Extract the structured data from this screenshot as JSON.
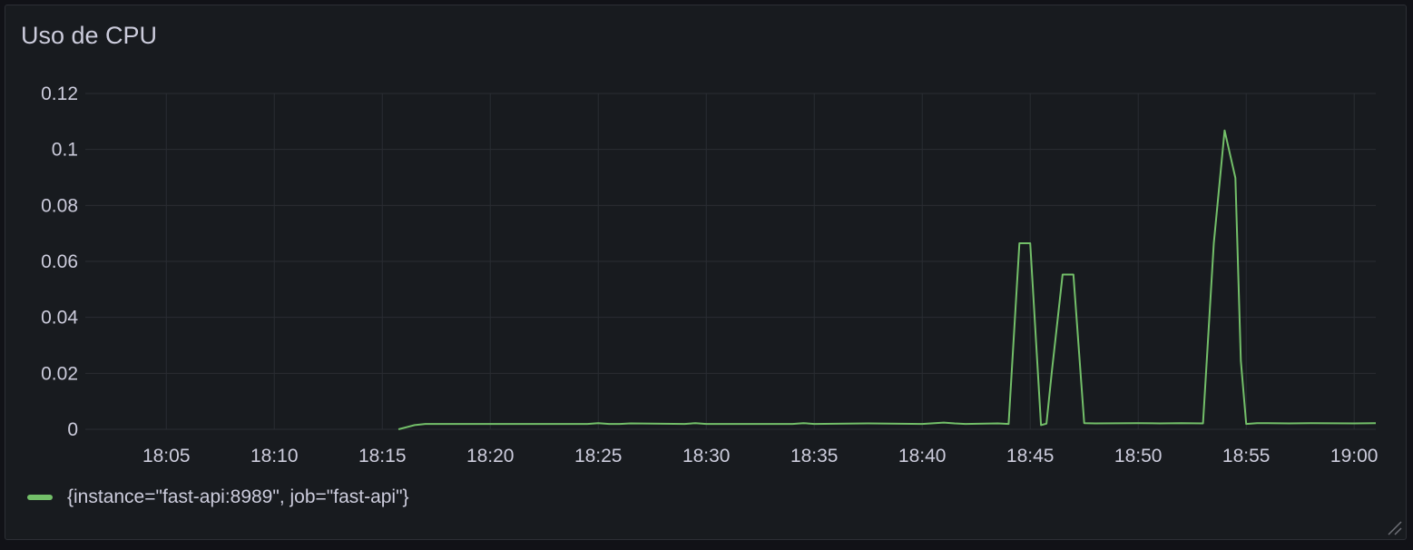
{
  "panel": {
    "title": "Uso de CPU"
  },
  "chart_data": {
    "type": "line",
    "title": "Uso de CPU",
    "xlabel": "",
    "ylabel": "",
    "x_ticks": [
      "18:05",
      "18:10",
      "18:15",
      "18:20",
      "18:25",
      "18:30",
      "18:35",
      "18:40",
      "18:45",
      "18:50",
      "18:55",
      "19:00"
    ],
    "y_ticks": [
      "0",
      "0.02",
      "0.04",
      "0.06",
      "0.08",
      "0.1",
      "0.12"
    ],
    "ylim": [
      0,
      0.12
    ],
    "xlim": [
      "18:01:15",
      "19:01:00"
    ],
    "grid": true,
    "legend_position": "bottom-left",
    "series": [
      {
        "name": "{instance=\"fast-api:8989\", job=\"fast-api\"}",
        "color": "#73bf69",
        "x": [
          "18:15:45",
          "18:16:30",
          "18:17:00",
          "18:24:30",
          "18:25:00",
          "18:25:30",
          "18:26:00",
          "18:26:30",
          "18:29:00",
          "18:29:30",
          "18:30:00",
          "18:34:00",
          "18:34:30",
          "18:35:00",
          "18:37:30",
          "18:40:00",
          "18:41:00",
          "18:41:30",
          "18:42:00",
          "18:43:30",
          "18:44:00",
          "18:44:30",
          "18:45:00",
          "18:45:30",
          "18:45:45",
          "18:46:00",
          "18:46:30",
          "18:47:00",
          "18:47:30",
          "18:48:00",
          "18:50:00",
          "18:51:00",
          "18:52:00",
          "18:53:00",
          "18:53:30",
          "18:54:00",
          "18:54:30",
          "18:54:45",
          "18:55:00",
          "18:55:30",
          "18:57:00",
          "18:58:00",
          "19:00:00",
          "19:01:00"
        ],
        "values": [
          0,
          0.0015,
          0.0019,
          0.0019,
          0.0022,
          0.0019,
          0.0019,
          0.0021,
          0.0019,
          0.0022,
          0.0019,
          0.0019,
          0.0022,
          0.0019,
          0.0021,
          0.0019,
          0.0024,
          0.0021,
          0.0019,
          0.0021,
          0.0019,
          0.0665,
          0.0665,
          0.0015,
          0.002,
          0.0205,
          0.0553,
          0.0553,
          0.0022,
          0.0021,
          0.0022,
          0.0021,
          0.0022,
          0.0021,
          0.0665,
          0.1068,
          0.0898,
          0.0245,
          0.0019,
          0.0022,
          0.0021,
          0.0022,
          0.0021,
          0.0022
        ]
      }
    ]
  }
}
